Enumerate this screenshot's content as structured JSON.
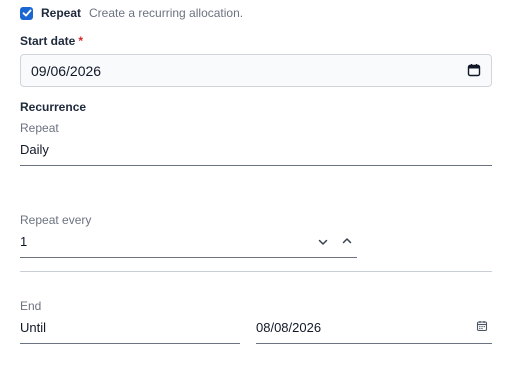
{
  "repeat": {
    "label": "Repeat",
    "help": "Create a recurring allocation.",
    "checked": true
  },
  "start_date": {
    "label": "Start date",
    "required_mark": "*",
    "value": "09/06/2026"
  },
  "recurrence": {
    "title": "Recurrence",
    "repeat_label": "Repeat",
    "repeat_value": "Daily",
    "repeat_every_label": "Repeat every",
    "repeat_every_value": "1",
    "end_label": "End",
    "end_mode_value": "Until",
    "end_date_value": "08/08/2026"
  },
  "colors": {
    "accent": "#1a66d2",
    "required": "#dc2626"
  },
  "icons": {
    "check": "check-icon",
    "calendar": "calendar-icon",
    "decrement": "chevron-down-icon",
    "increment": "chevron-up-icon"
  }
}
